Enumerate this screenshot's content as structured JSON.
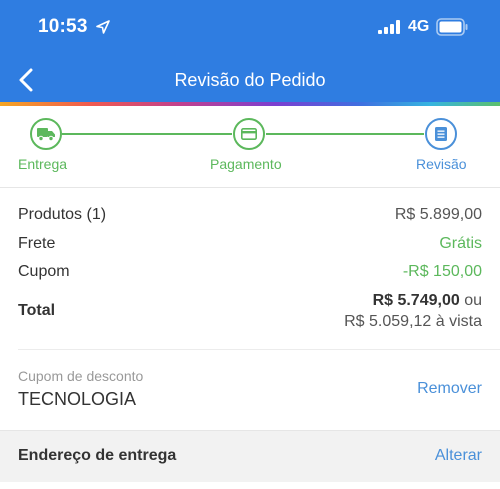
{
  "status_bar": {
    "time": "10:53",
    "network": "4G",
    "location_icon": "location-arrow-icon",
    "signal_icon": "signal-bars-icon",
    "battery_icon": "battery-icon"
  },
  "nav": {
    "title": "Revisão do Pedido",
    "back_icon": "chevron-left-icon"
  },
  "colors": {
    "header": "#2f7de1",
    "step_done": "#5cb85c",
    "step_current": "#4a90d9",
    "link": "#4a90d9"
  },
  "steps": [
    {
      "label": "Entrega",
      "icon": "truck-icon",
      "state": "done"
    },
    {
      "label": "Pagamento",
      "icon": "credit-card-icon",
      "state": "done"
    },
    {
      "label": "Revisão",
      "icon": "list-icon",
      "state": "current"
    }
  ],
  "summary": {
    "products_label": "Produtos (1)",
    "products_value": "R$ 5.899,00",
    "shipping_label": "Frete",
    "shipping_value": "Grátis",
    "coupon_label": "Cupom",
    "coupon_value": "-R$ 150,00",
    "total_label": "Total",
    "total_value": "R$ 5.749,00",
    "total_or": "ou",
    "total_cash": "R$ 5.059,12 à vista"
  },
  "coupon": {
    "label": "Cupom de desconto",
    "code": "TECNOLOGIA",
    "action": "Remover"
  },
  "address": {
    "title": "Endereço de entrega",
    "action": "Alterar"
  }
}
